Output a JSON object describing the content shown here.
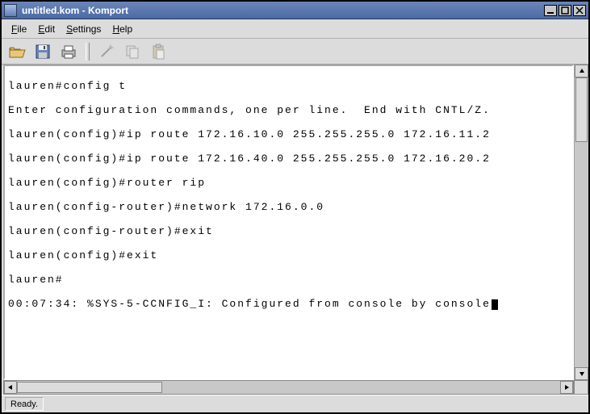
{
  "window": {
    "title": "untitled.kom - Komport"
  },
  "menubar": {
    "file": "File",
    "edit": "Edit",
    "settings": "Settings",
    "help": "Help"
  },
  "toolbar": {
    "open": "open",
    "save": "save",
    "print": "print",
    "wand": "wand",
    "copy": "copy",
    "paste": "paste"
  },
  "terminal": {
    "lines": [
      "lauren#config t",
      "Enter configuration commands, one per line.  End with CNTL/Z.",
      "lauren(config)#ip route 172.16.10.0 255.255.255.0 172.16.11.2",
      "lauren(config)#ip route 172.16.40.0 255.255.255.0 172.16.20.2",
      "lauren(config)#router rip",
      "lauren(config-router)#network 172.16.0.0",
      "lauren(config-router)#exit",
      "lauren(config)#exit",
      "lauren#",
      "00:07:34: %SYS-5-CCNFIG_I: Configured from console by console"
    ]
  },
  "status": {
    "text": "Ready."
  }
}
